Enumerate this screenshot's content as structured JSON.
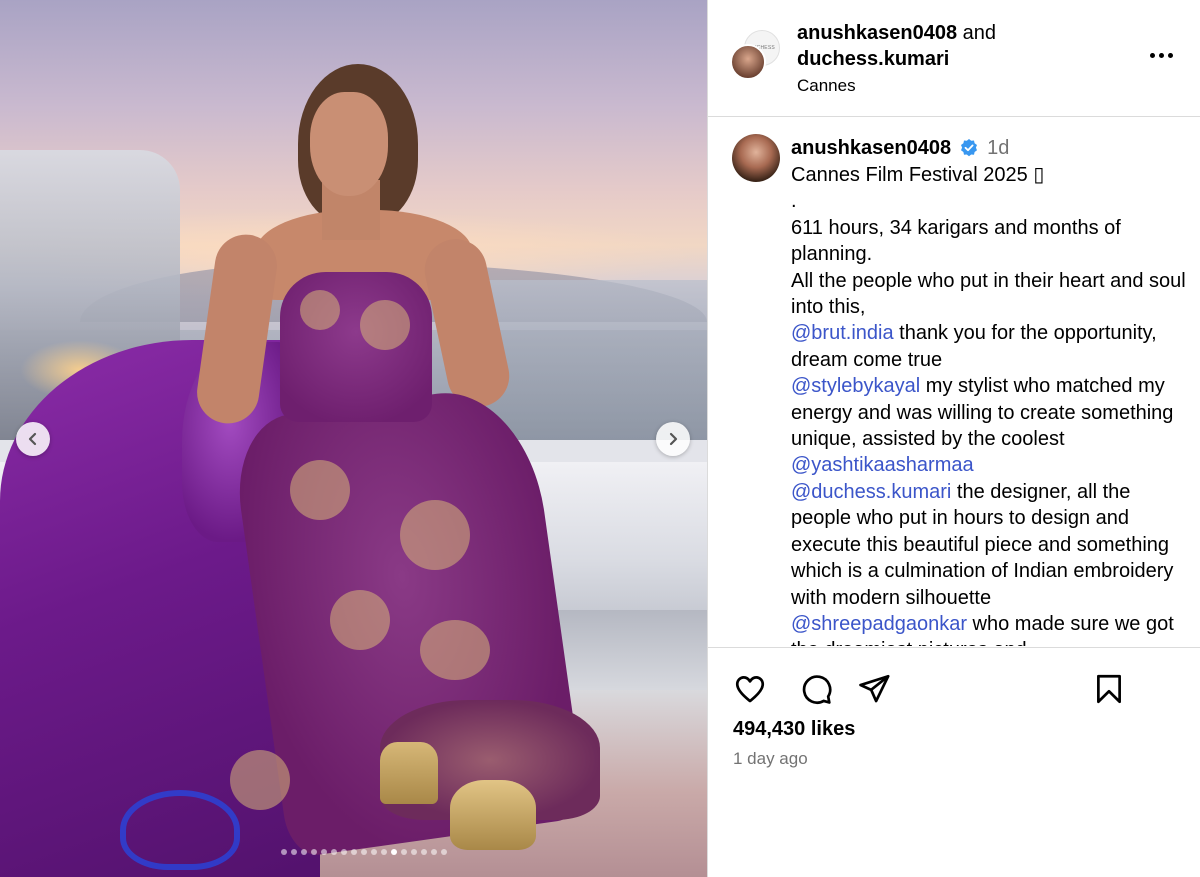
{
  "post": {
    "authors": {
      "primary": "anushkasen0408",
      "joiner": "and",
      "secondary": "duchess.kumari"
    },
    "location": "Cannes",
    "collab_avatar_mark": "DUCHESS"
  },
  "caption": {
    "username": "anushkasen0408",
    "time": "1d",
    "title": "Cannes Film Festival 2025 ",
    "title_glyph": "▯",
    "dot": ".",
    "line1": "611 hours, 34 karigars and months of planning.",
    "line2": "All the people who put in their heart and soul into this,",
    "mention1": "@brut.india",
    "line3": " thank you for the opportunity, dream come true",
    "mention2": "@stylebykayal",
    "line4": " my stylist who matched my energy and was willing to create something unique, assisted by the coolest",
    "mention3": "@yashtikaasharmaa",
    "mention4": "@duchess.kumari",
    "line5": " the designer, all the people who put in hours to design and execute this beautiful piece and something which is a culmination of Indian embroidery with modern silhouette",
    "mention5": "@shreepadgaonkar",
    "line6": " who made sure we got the dreamiest pictures and"
  },
  "stats": {
    "likes": "494,430 likes",
    "ago": "1 day ago"
  },
  "carousel": {
    "total": 17,
    "active_index": 11
  },
  "colors": {
    "mention": "#3b55c9",
    "verified": "#3897f0",
    "muted": "#737373",
    "divider": "#dbdbdb"
  },
  "icons": {
    "prev": "chevron-left-icon",
    "next": "chevron-right-icon",
    "like": "heart-icon",
    "comment": "comment-icon",
    "share": "paper-plane-icon",
    "save": "bookmark-icon",
    "more": "more-dots-icon",
    "verified": "verified-badge-icon"
  }
}
